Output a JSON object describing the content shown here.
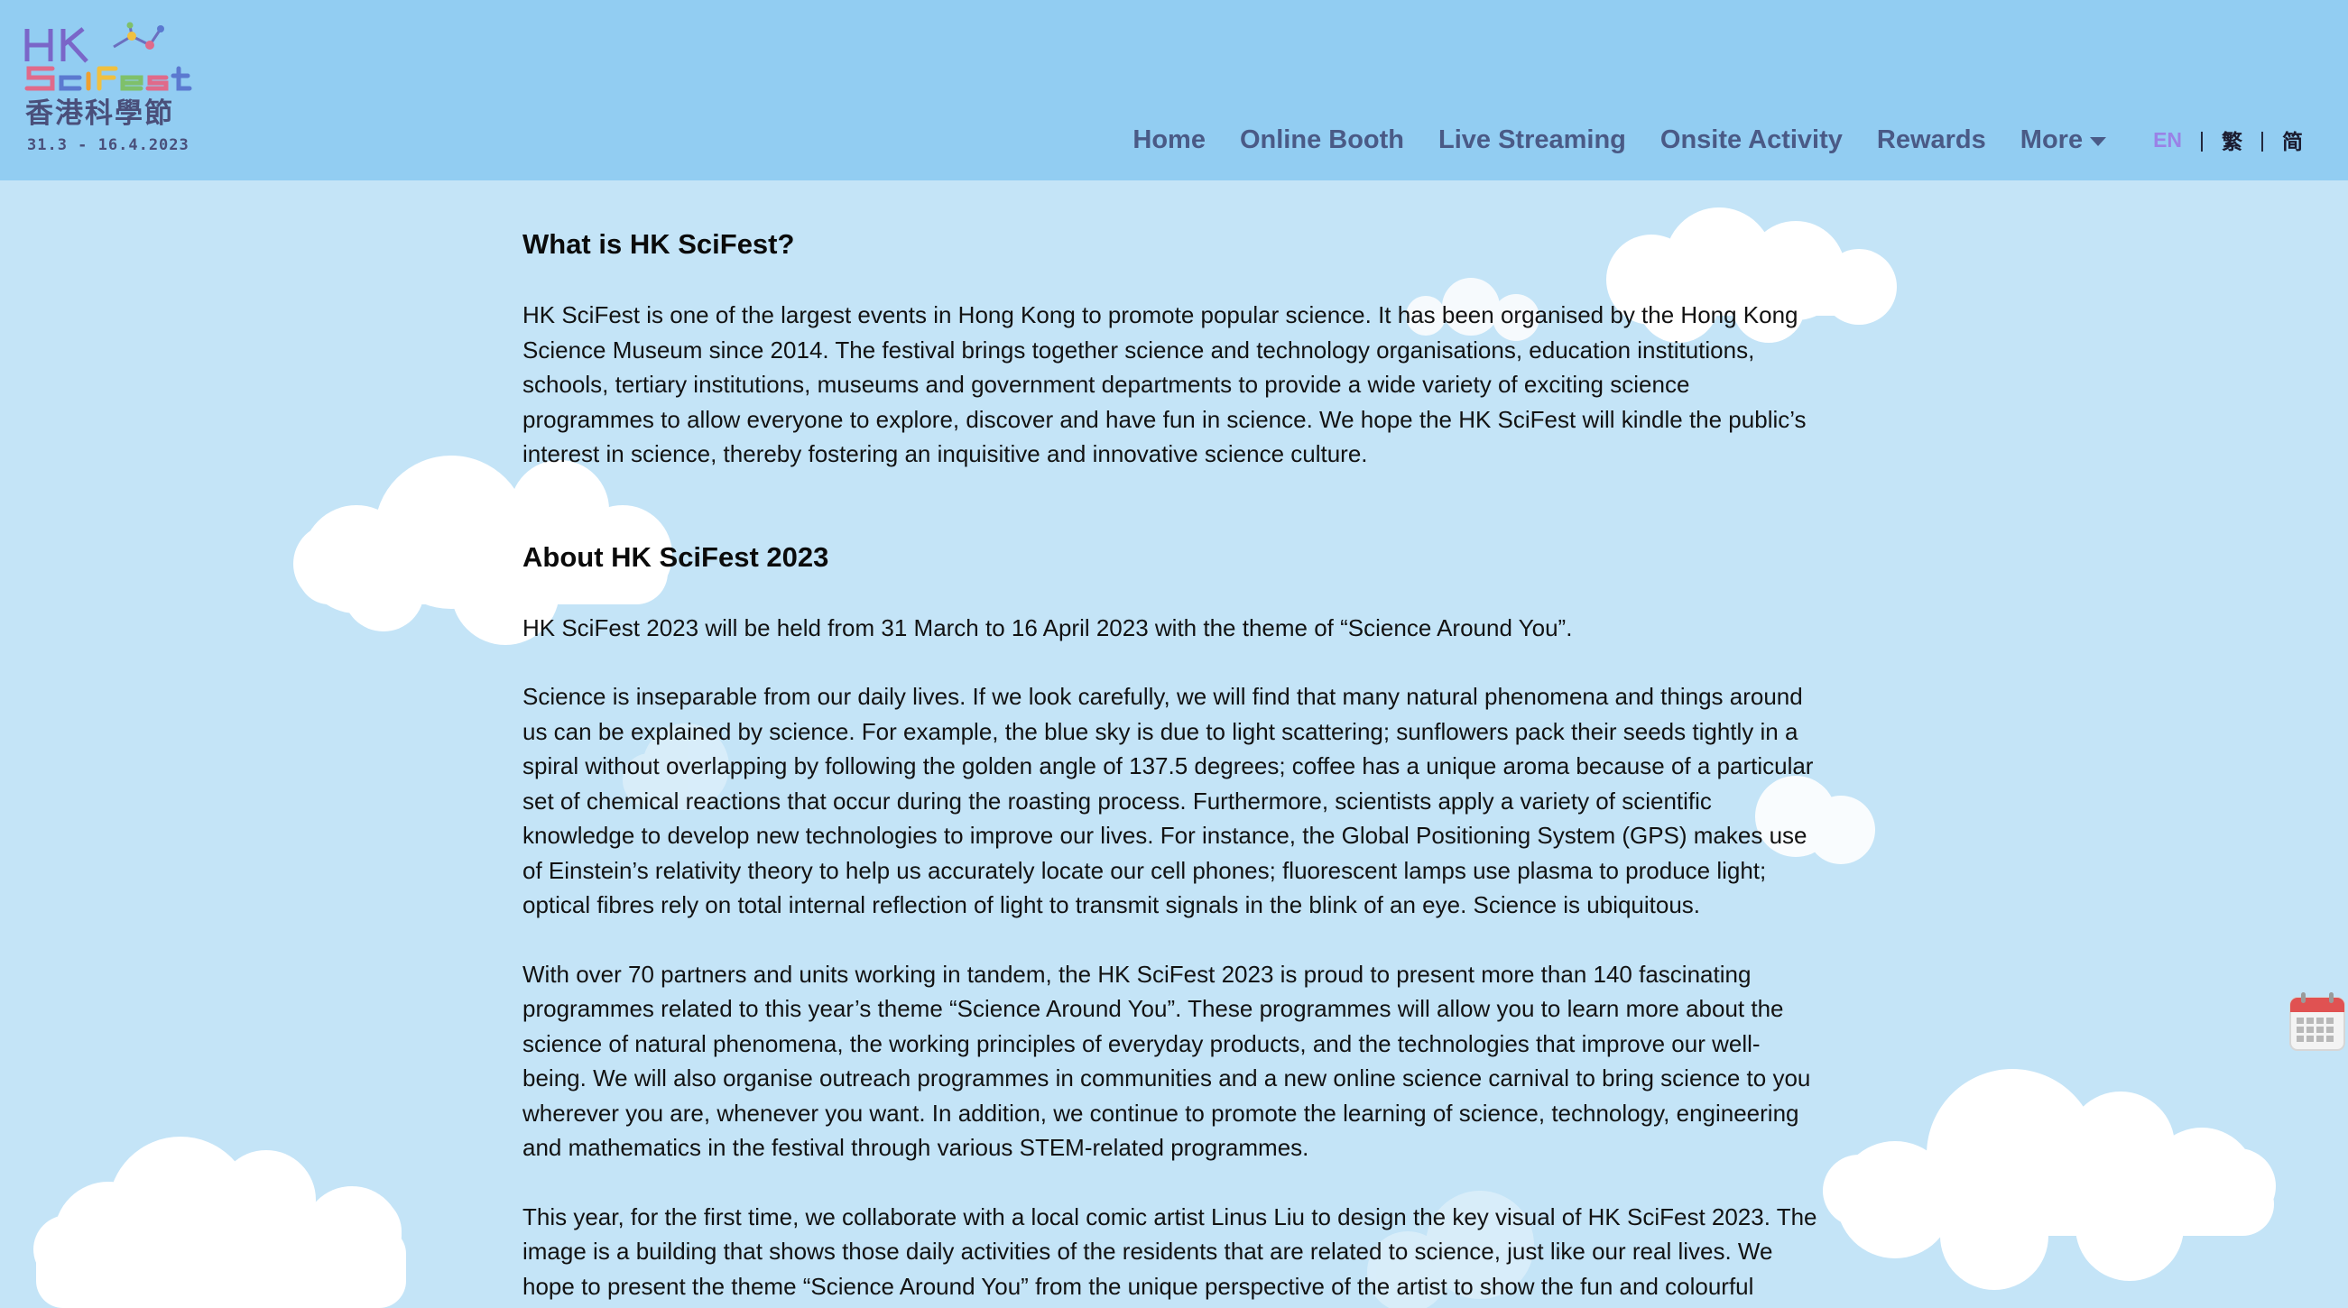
{
  "logo": {
    "alt_text_lines": [
      "HK",
      "SciFest",
      "香港科學節",
      "31.3 - 16.4.2023"
    ]
  },
  "nav": {
    "items": [
      "Home",
      "Online Booth",
      "Live Streaming",
      "Onsite Activity",
      "Rewards",
      "More"
    ],
    "languages": [
      "EN",
      "繁",
      "简"
    ],
    "active_language": "EN"
  },
  "content": {
    "what_heading": "What is HK SciFest?",
    "what_body": "HK SciFest is one of the largest events in Hong Kong to promote popular science. It has been organised by the Hong Kong Science Museum since 2014. The festival brings together science and technology organisations, education institutions, schools, tertiary institutions, museums and government departments to provide a wide variety of exciting science programmes to allow everyone to explore, discover and have fun in science. We hope the HK SciFest will kindle the public’s interest in science, thereby fostering an inquisitive and innovative science culture.",
    "about_heading": "About HK SciFest 2023",
    "about_paragraphs": [
      "HK SciFest 2023 will be held from 31 March to 16 April 2023 with the theme of “Science Around You”.",
      "Science is inseparable from our daily lives. If we look carefully, we will find that many natural phenomena and things around us can be explained by science. For example, the blue sky is due to light scattering; sunflowers pack their seeds tightly in a spiral without overlapping by following the golden angle of 137.5 degrees; coffee has a unique aroma because of a particular set of chemical reactions that occur during the roasting process. Furthermore, scientists apply a variety of scientific knowledge to develop new technologies to improve our lives. For instance, the Global Positioning System (GPS) makes use of Einstein’s relativity theory to help us accurately locate our cell phones; fluorescent lamps use plasma to produce light; optical fibres rely on total internal reflection of light to transmit signals in the blink of an eye. Science is ubiquitous.",
      "With over 70 partners and units working in tandem, the HK SciFest 2023 is proud to present more than 140 fascinating programmes related to this year’s theme “Science Around You”. These programmes will allow you to learn more about the science of natural phenomena, the working principles of everyday products, and the technologies that improve our well-being. We will also organise outreach programmes in communities and a new online science carnival to bring science to you wherever you are, whenever you want. In addition, we continue to promote the learning of science, technology, engineering and mathematics in the festival through various STEM-related programmes.",
      "This year, for the first time, we collaborate with a local comic artist Linus Liu to design the key visual of HK SciFest 2023. The image is a building that shows those daily activities of the residents that are related to science, just like our real lives. We hope to present the theme “Science Around You” from the unique perspective of the artist to show the fun and colourful"
    ]
  },
  "colors": {
    "header_bg": "#92cdf2",
    "page_bg": "#c4e4f7",
    "nav_text": "#4a5a86",
    "lang_active": "#9a82e6"
  },
  "icons": {
    "floating_button": "calendar-icon",
    "more_caret": "caret-down-icon"
  }
}
